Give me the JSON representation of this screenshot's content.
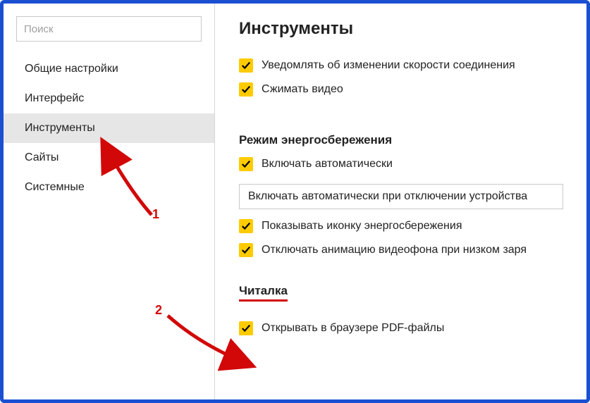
{
  "search": {
    "placeholder": "Поиск"
  },
  "sidebar": {
    "items": [
      {
        "label": "Общие настройки"
      },
      {
        "label": "Интерфейс"
      },
      {
        "label": "Инструменты"
      },
      {
        "label": "Сайты"
      },
      {
        "label": "Системные"
      }
    ]
  },
  "page": {
    "title": "Инструменты"
  },
  "top_options": [
    {
      "label": "Уведомлять об изменении скорости соединения",
      "checked": true
    },
    {
      "label": "Сжимать видео",
      "checked": true
    }
  ],
  "energy": {
    "section_title": "Режим энергосбережения",
    "opt_auto": {
      "label": "Включать автоматически",
      "checked": true
    },
    "select_value": "Включать автоматически при отключении устройства",
    "opt_icon": {
      "label": "Показывать иконку энергосбережения",
      "checked": true
    },
    "opt_anim": {
      "label": "Отключать анимацию видеофона при низком заря",
      "checked": true
    }
  },
  "reader": {
    "section_title": "Читалка",
    "opt_pdf": {
      "label": "Открывать в браузере PDF-файлы",
      "checked": true
    }
  },
  "annotations": {
    "n1": "1",
    "n2": "2"
  }
}
